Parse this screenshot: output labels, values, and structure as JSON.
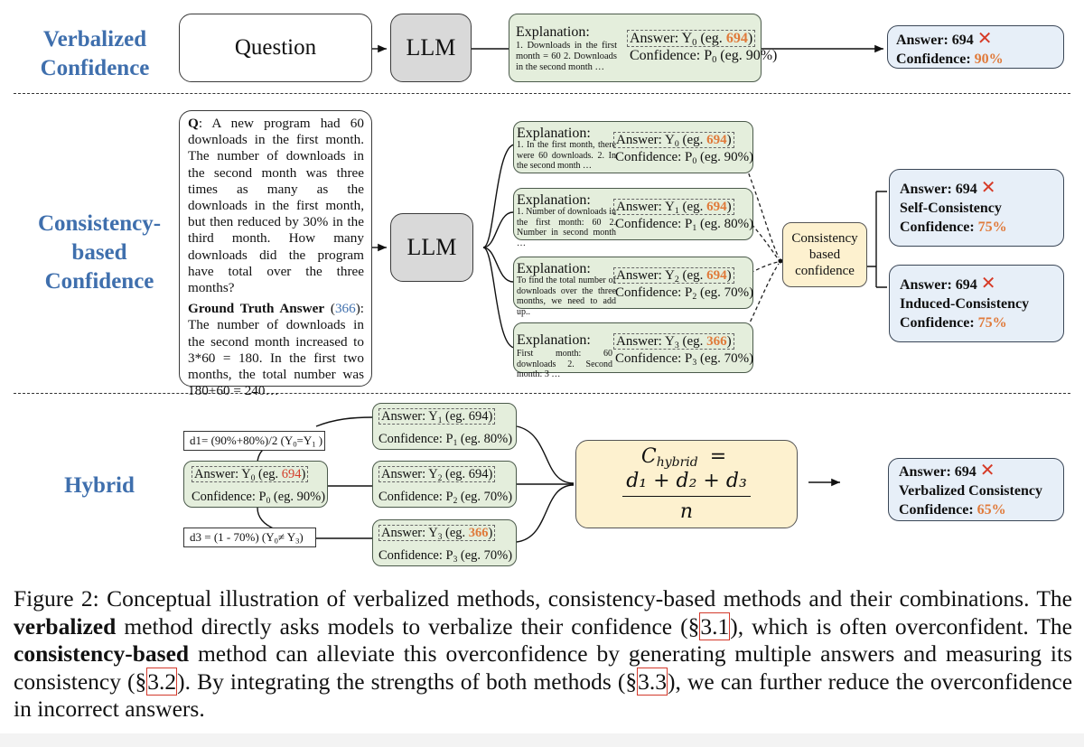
{
  "sections": {
    "verbalized": {
      "label_line1": "Verbalized",
      "label_line2": "Confidence"
    },
    "consistency": {
      "label_line1": "Consistency-",
      "label_line2": "based",
      "label_line3": "Confidence"
    },
    "hybrid": {
      "label": "Hybrid"
    }
  },
  "verbalized_row": {
    "question_label": "Question",
    "llm_label": "LLM",
    "explanation": {
      "title": "Explanation:",
      "body": "1. Downloads in the first month = 60 2. Downloads in the second month …",
      "answer_prefix": "Answer: Y",
      "answer_sub": "0",
      "answer_eg": " (eg. ",
      "answer_value": "694",
      "answer_close": ")",
      "conf_prefix": "Confidence: P",
      "conf_sub": "0",
      "conf_value": " (eg. 90%)"
    },
    "result": {
      "answer_label": "Answer: 694",
      "confidence_label": "Confidence:",
      "confidence_value": "90%",
      "status_icon": "x-mark-icon"
    }
  },
  "consistency_row": {
    "question": {
      "q_label": "Q",
      "q_text": ": A new program had 60 downloads in the first month. The number of downloads in the second month was three times as many as the downloads in the first month, but then reduced by 30% in the third month. How many downloads did the program have total over the three months?",
      "gt_label": "Ground Truth Answer",
      "gt_open": " (",
      "gt_value": "366",
      "gt_close": "):",
      "gt_text": "The number of downloads in the second month increased to 3*60 = 180. In the first two months, the total number was 180+60 = 240…"
    },
    "llm_label": "LLM",
    "samples": [
      {
        "title": "Explanation:",
        "body": "1. In the first month, there were 60 downloads. 2. In the second month …",
        "sub": "0",
        "answer_value": "694",
        "conf_value": " (eg. 90%)"
      },
      {
        "title": "Explanation:",
        "body": "1. Number of downloads in the first month: 60 2. Number in second month …",
        "sub": "1",
        "answer_value": "694",
        "conf_value": " (eg. 80%)"
      },
      {
        "title": "Explanation:",
        "body": "To find the total number of downloads over the three months, we need to add up..",
        "sub": "2",
        "answer_value": "694",
        "conf_value": " (eg. 70%)"
      },
      {
        "title": "Explanation:",
        "body": "First month: 60 downloads 2. Second month: 3 …",
        "sub": "3",
        "answer_value": "366",
        "conf_value": " (eg. 70%)"
      }
    ],
    "answer_prefix": "Answer: Y",
    "answer_eg": " (eg. ",
    "answer_close": ")",
    "conf_prefix": "Confidence: P",
    "aggregator_label": "Consistency based confidence",
    "results": [
      {
        "answer_label": "Answer: 694",
        "method_label": "Self-Consistency",
        "confidence_label": "Confidence:",
        "confidence_value": "75%",
        "status_icon": "x-mark-icon"
      },
      {
        "answer_label": "Answer: 694",
        "method_label": "Induced-Consistency",
        "confidence_label": "Confidence:",
        "confidence_value": "75%",
        "status_icon": "x-mark-icon"
      }
    ]
  },
  "hybrid_row": {
    "base": {
      "answer_prefix": "Answer: Y",
      "sub": "0",
      "answer_eg": " (eg. ",
      "answer_value": "694",
      "answer_close": ")",
      "conf_prefix": "Confidence: P",
      "conf_value": " (eg. 90%)"
    },
    "d1": {
      "text_a": "d1= (90%+80%)/2 (Y",
      "sub_a": "0",
      "text_b": "=Y",
      "sub_b": "1",
      "text_c": " )"
    },
    "d3": {
      "text_a": "d3 = (1 - 70%)  (Y",
      "sub_a": "0",
      "text_b": "≠ Y",
      "sub_b": "3",
      "text_c": ")"
    },
    "samples": [
      {
        "sub": "1",
        "answer_value": "694",
        "highlight": false,
        "conf_value": " (eg. 80%)"
      },
      {
        "sub": "2",
        "answer_value": "694",
        "highlight": false,
        "conf_value": " (eg. 70%)"
      },
      {
        "sub": "3",
        "answer_value": "366",
        "highlight": true,
        "conf_value": " (eg. 70%)"
      }
    ],
    "formula": {
      "lhs": "C",
      "lhs_sub": "hybrid",
      "eq": "=",
      "numerator": "d₁ + d₂ + d₃",
      "denominator": "n"
    },
    "result": {
      "answer_label": "Answer: 694",
      "method_label": "Verbalized Consistency",
      "confidence_label": "Confidence:",
      "confidence_value": "65%",
      "status_icon": "x-mark-icon"
    }
  },
  "caption": {
    "p1": "Figure 2:  Conceptual illustration of verbalized methods, consistency-based methods and their combinations. The ",
    "b1": "verbalized",
    "p2": " method directly asks models to verbalize their confidence (§",
    "ref1": "3.1",
    "p3": "), which is often overconfident. The ",
    "b2": "consistency-based",
    "p4": " method can alleviate this overconfidence by generating multiple answers and measuring its consistency (§",
    "ref2": "3.2",
    "p5": "). By integrating the strengths of both methods (§",
    "ref3": "3.3",
    "p6": "), we can further reduce the overconfidence in incorrect answers."
  },
  "colors": {
    "label_blue": "#3f6fad",
    "highlight_orange": "#e07a3a",
    "wrong_red": "#d63a26",
    "green_box": "#e4eedc",
    "blue_box": "#e7eff8",
    "yellow_box": "#fdf1cf",
    "llm_gray": "#d9d9d9"
  }
}
